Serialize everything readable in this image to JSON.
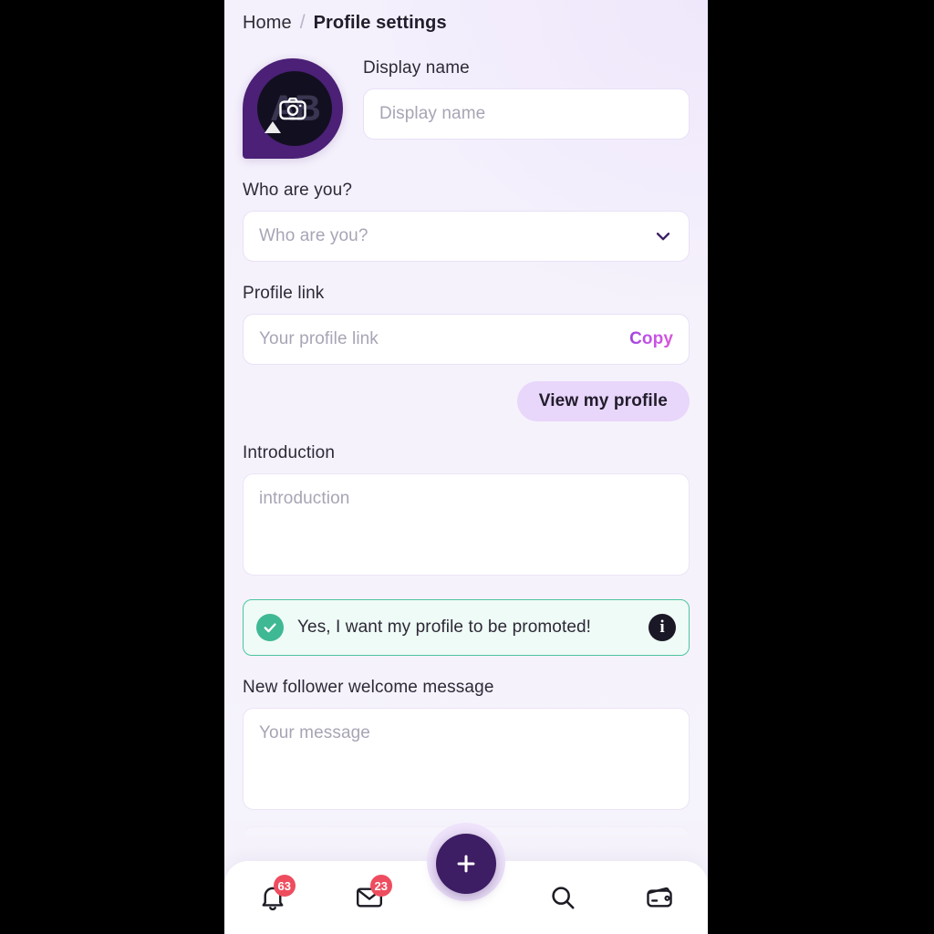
{
  "breadcrumb": {
    "home": "Home",
    "separator": "/",
    "current": "Profile settings"
  },
  "avatar": {
    "initials": "AB",
    "camera_icon": "camera-icon"
  },
  "display_name": {
    "label": "Display name",
    "placeholder": "Display name",
    "value": ""
  },
  "who_are_you": {
    "label": "Who are you?",
    "placeholder": "Who are you?",
    "value": "",
    "chevron_icon": "chevron-down-icon"
  },
  "profile_link": {
    "label": "Profile link",
    "placeholder": "Your profile link",
    "value": "",
    "copy_label": "Copy"
  },
  "view_profile": {
    "label": "View my profile"
  },
  "introduction": {
    "label": "Introduction",
    "placeholder": "introduction",
    "value": ""
  },
  "promoted": {
    "text": "Yes, I want my profile to be promoted!",
    "checked": true,
    "check_icon": "check-icon",
    "info_icon": "info-icon",
    "info_glyph": "i",
    "accent_color": "#3fb894",
    "border_color": "#4ec4a0",
    "background_color": "#effbf6"
  },
  "welcome_message": {
    "label": "New follower welcome message",
    "placeholder": "Your message",
    "value": ""
  },
  "bottom_nav": {
    "items": [
      {
        "name": "notifications",
        "icon": "bell-icon",
        "badge": "63"
      },
      {
        "name": "messages",
        "icon": "envelope-icon",
        "badge": "23"
      },
      {
        "name": "search",
        "icon": "search-icon",
        "badge": ""
      },
      {
        "name": "wallet",
        "icon": "wallet-icon",
        "badge": ""
      }
    ],
    "fab": {
      "icon": "plus-icon",
      "color": "#3d1d63"
    },
    "badge_color": "#ee4d5f"
  },
  "theme": {
    "page_background": "#f5f2fb",
    "primary_purple": "#4b2076",
    "accent_pill": "#e8d6fb",
    "copy_gradient_start": "#8b3fd6",
    "copy_gradient_end": "#d855d8"
  }
}
